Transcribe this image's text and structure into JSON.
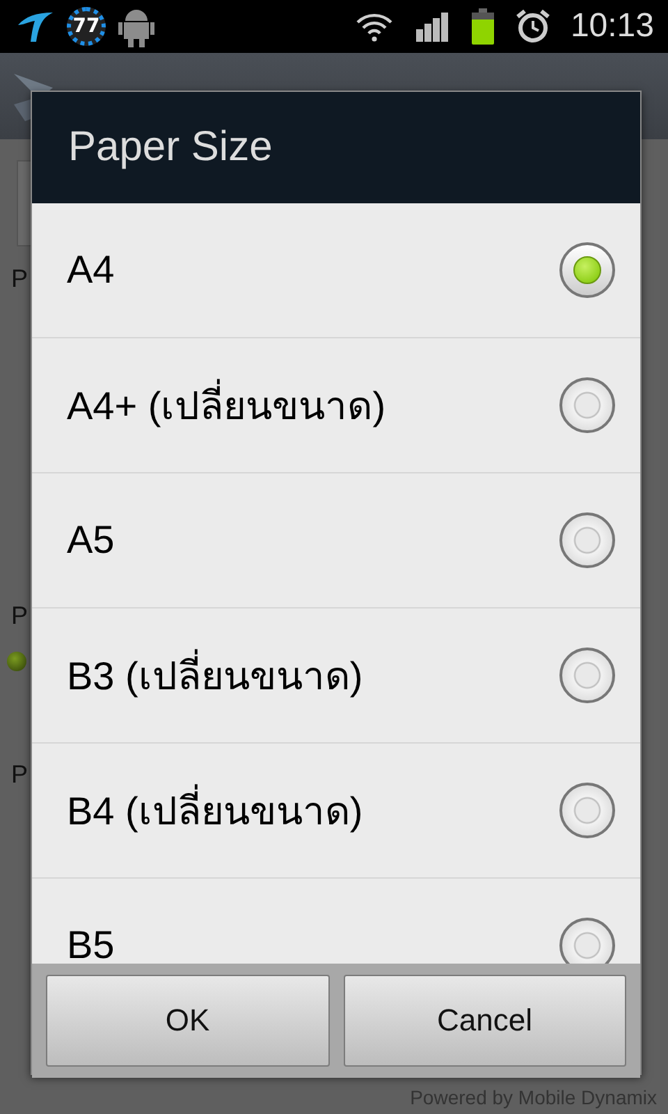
{
  "status_bar": {
    "badge": "77",
    "time": "10:13"
  },
  "background": {
    "labels": [
      "P",
      "P",
      "P"
    ]
  },
  "dialog": {
    "title": "Paper Size",
    "options": [
      {
        "label": "A4",
        "selected": true
      },
      {
        "label": "A4+ (เปลี่ยนขนาด)",
        "selected": false
      },
      {
        "label": "A5",
        "selected": false
      },
      {
        "label": "B3 (เปลี่ยนขนาด)",
        "selected": false
      },
      {
        "label": "B4 (เปลี่ยนขนาด)",
        "selected": false
      },
      {
        "label": "B5",
        "selected": false
      }
    ],
    "buttons": [
      "OK",
      "Cancel"
    ]
  },
  "footer": "Powered by Mobile Dynamix"
}
